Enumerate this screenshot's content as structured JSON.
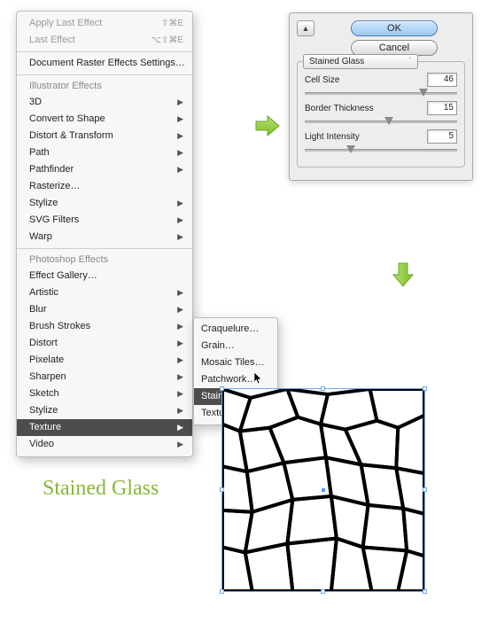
{
  "menu": {
    "apply_last": "Apply Last Effect",
    "apply_last_sc": "⇧⌘E",
    "last_effect": "Last Effect",
    "last_effect_sc": "⌥⇧⌘E",
    "raster_settings": "Document Raster Effects Settings…",
    "header_illustrator": "Illustrator Effects",
    "il_items": [
      "3D",
      "Convert to Shape",
      "Distort & Transform",
      "Path",
      "Pathfinder",
      "Rasterize…",
      "Stylize",
      "SVG Filters",
      "Warp"
    ],
    "header_photoshop": "Photoshop Effects",
    "ps_gallery": "Effect Gallery…",
    "ps_items": [
      "Artistic",
      "Blur",
      "Brush Strokes",
      "Distort",
      "Pixelate",
      "Sharpen",
      "Sketch",
      "Stylize",
      "Texture",
      "Video"
    ],
    "highlight_index": 8
  },
  "submenu": {
    "items": [
      "Craquelure…",
      "Grain…",
      "Mosaic Tiles…",
      "Patchwork…",
      "Stained Glass…",
      "Texturizer…"
    ],
    "highlight_index": 4
  },
  "dialog": {
    "ok": "OK",
    "cancel": "Cancel",
    "group_name": "Stained Glass",
    "controls": [
      {
        "label": "Cell Size",
        "value": "46",
        "knob": 0.78
      },
      {
        "label": "Border Thickness",
        "value": "15",
        "knob": 0.55
      },
      {
        "label": "Light Intensity",
        "value": "5",
        "knob": 0.3
      }
    ]
  },
  "title": "Stained Glass"
}
